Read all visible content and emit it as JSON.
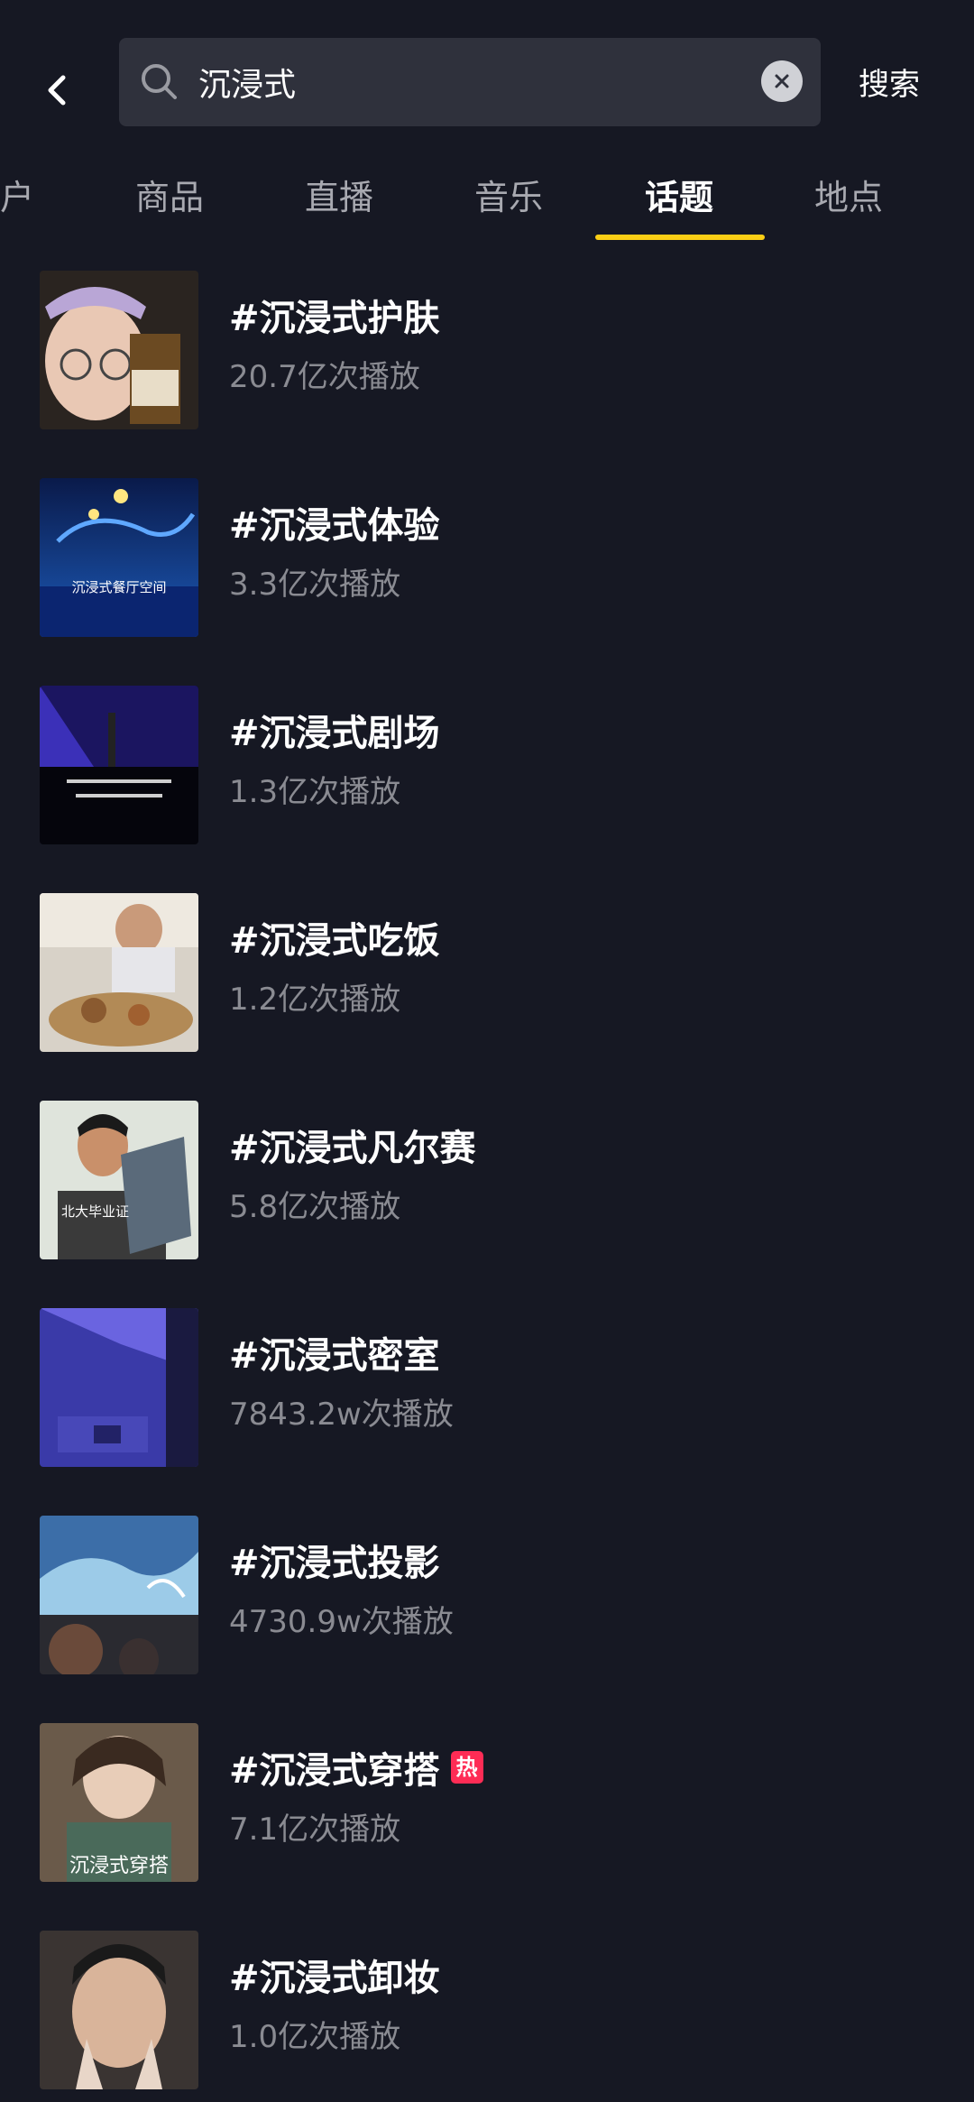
{
  "search": {
    "query": "沉浸式",
    "submit_label": "搜索"
  },
  "tabs": [
    {
      "label": "户",
      "active": false
    },
    {
      "label": "商品",
      "active": false
    },
    {
      "label": "直播",
      "active": false
    },
    {
      "label": "音乐",
      "active": false
    },
    {
      "label": "话题",
      "active": true
    },
    {
      "label": "地点",
      "active": false
    }
  ],
  "topics": [
    {
      "title": "#沉浸式护肤",
      "plays": "20.7亿次播放",
      "hot": false
    },
    {
      "title": "#沉浸式体验",
      "plays": "3.3亿次播放",
      "hot": false,
      "thumb_caption": "沉浸式餐厅空间"
    },
    {
      "title": "#沉浸式剧场",
      "plays": "1.3亿次播放",
      "hot": false
    },
    {
      "title": "#沉浸式吃饭",
      "plays": "1.2亿次播放",
      "hot": false
    },
    {
      "title": "#沉浸式凡尔赛",
      "plays": "5.8亿次播放",
      "hot": false,
      "thumb_caption": "北大毕业证"
    },
    {
      "title": "#沉浸式密室",
      "plays": "7843.2w次播放",
      "hot": false
    },
    {
      "title": "#沉浸式投影",
      "plays": "4730.9w次播放",
      "hot": false
    },
    {
      "title": "#沉浸式穿搭",
      "plays": "7.1亿次播放",
      "hot": true,
      "hot_label": "热",
      "thumb_caption": "沉浸式穿搭"
    },
    {
      "title": "#沉浸式卸妆",
      "plays": "1.0亿次播放",
      "hot": false
    }
  ],
  "colors": {
    "background": "#161823",
    "accent_underline": "#face15",
    "hot_badge": "#fe2c55"
  },
  "icons": {
    "back": "chevron-left-icon",
    "search": "search-icon",
    "clear": "close-icon"
  }
}
